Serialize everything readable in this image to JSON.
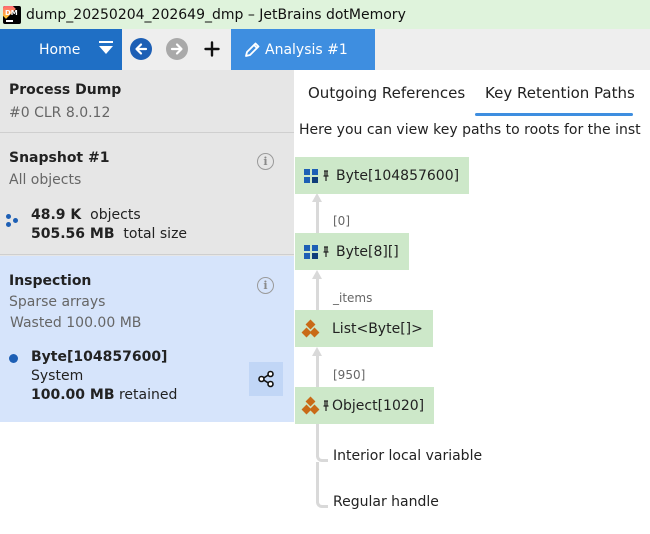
{
  "window": {
    "title": "dump_20250204_202649_dmp – JetBrains dotMemory",
    "logo_text": "DM"
  },
  "toolbar": {
    "home_label": "Home",
    "analysis_tab_label": "Analysis #1"
  },
  "left_panel": {
    "process": {
      "title": "Process Dump",
      "subtitle": "#0 CLR 8.0.12"
    },
    "snapshot": {
      "title": "Snapshot #1",
      "subtitle": "All objects",
      "objects_value": "48.9 K",
      "objects_label": "objects",
      "size_value": "505.56 MB",
      "size_label": "total size"
    },
    "inspection": {
      "title": "Inspection",
      "subtitle": "Sparse arrays",
      "wasted": "Wasted 100.00 MB",
      "item_name": "Byte[104857600]",
      "item_root": "System",
      "retained_value": "100.00 MB",
      "retained_label": "retained"
    }
  },
  "right_panel": {
    "tabs": [
      {
        "label": "Outgoing References",
        "active": false
      },
      {
        "label": "Key Retention Paths",
        "active": true
      }
    ],
    "description": "Here you can view key paths to roots for the inst",
    "nodes": [
      {
        "label": "Byte[104857600]",
        "kind": "array",
        "icon": "array-icon"
      },
      {
        "label": "Byte[8][]",
        "kind": "array",
        "icon": "array-icon"
      },
      {
        "label": "List<Byte[]>",
        "kind": "class",
        "icon": "class-icon"
      },
      {
        "label": "Object[1020]",
        "kind": "class",
        "icon": "class-icon"
      }
    ],
    "edges": [
      "[0]",
      "_items",
      "[950]"
    ],
    "roots": [
      "Interior local variable",
      "Regular handle"
    ]
  },
  "colors": {
    "accent_blue": "#1f6fc5",
    "tab_blue": "#3e8ee0",
    "node_green": "#cde8c9",
    "inspection_bg": "#d6e4fb",
    "title_bar_green": "#dff3dc"
  }
}
